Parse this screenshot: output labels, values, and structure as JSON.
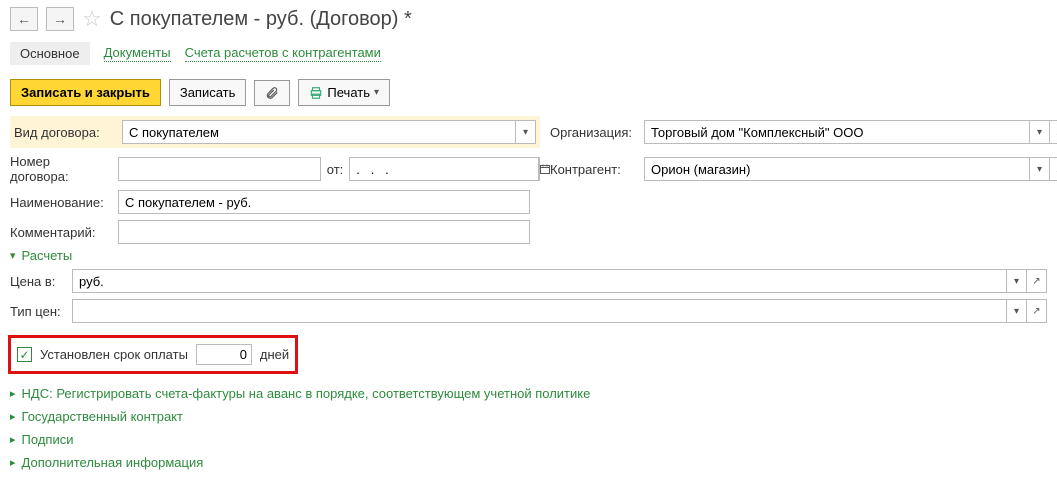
{
  "title": "С покупателем - руб. (Договор) *",
  "tabs": {
    "main": "Основное",
    "docs": "Документы",
    "accounts": "Счета расчетов с контрагентами"
  },
  "toolbar": {
    "save_close": "Записать и закрыть",
    "save": "Записать",
    "print": "Печать"
  },
  "labels": {
    "contract_type": "Вид договора:",
    "organization": "Организация:",
    "contract_no": "Номер договора:",
    "from": "от:",
    "counterparty": "Контрагент:",
    "name": "Наименование:",
    "comment": "Комментарий:",
    "price_in": "Цена в:",
    "price_type": "Тип цен:",
    "days": "дней"
  },
  "values": {
    "contract_type": "С покупателем",
    "organization": "Торговый дом \"Комплексный\" ООО",
    "contract_no": "",
    "date": ".   .   .",
    "counterparty": "Орион (магазин)",
    "name": "С покупателем - руб.",
    "comment": "",
    "currency": "руб.",
    "price_type": "",
    "days": "0"
  },
  "sections": {
    "calc": "Расчеты",
    "due": "Установлен срок оплаты",
    "vat": "НДС: Регистрировать счета-фактуры на аванс в порядке, соответствующем учетной политике",
    "gov": "Государственный контракт",
    "sign": "Подписи",
    "extra": "Дополнительная информация"
  }
}
